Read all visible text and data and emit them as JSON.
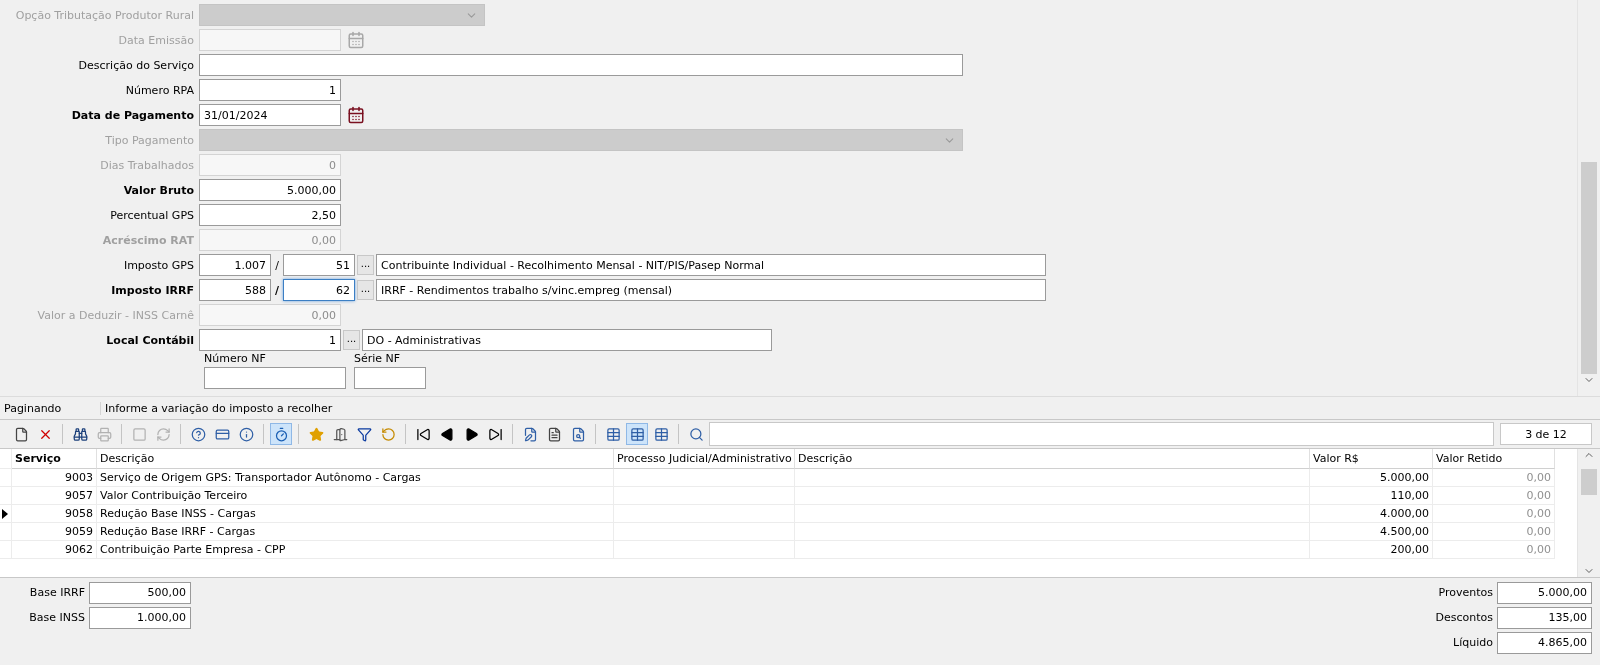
{
  "form": {
    "rows": [
      {
        "kind": "select",
        "label": "Opção Tributação Produtor Rural",
        "disabled": true,
        "bold": false
      },
      {
        "kind": "date",
        "label": "Data Emissão",
        "disabled": true,
        "bold": false
      },
      {
        "kind": "text",
        "label": "Descrição do Serviço",
        "disabled": false,
        "bold": false
      },
      {
        "kind": "number",
        "label": "Número RPA",
        "value": "1",
        "disabled": false,
        "bold": false
      },
      {
        "kind": "date",
        "label": "Data de Pagamento",
        "value": "31/01/2024",
        "disabled": false,
        "bold": true
      },
      {
        "kind": "wide-select",
        "label": "Tipo Pagamento",
        "disabled": true,
        "bold": false
      },
      {
        "kind": "number",
        "label": "Dias Trabalhados",
        "value": "0",
        "disabled": true,
        "bold": false
      },
      {
        "kind": "number",
        "label": "Valor Bruto",
        "value": "5.000,00",
        "disabled": false,
        "bold": true
      },
      {
        "kind": "number",
        "label": "Percentual GPS",
        "value": "2,50",
        "disabled": false,
        "bold": false
      },
      {
        "kind": "number",
        "label": "Acréscimo RAT",
        "value": "0,00",
        "disabled": true,
        "bold": true
      },
      {
        "kind": "code",
        "label": "Imposto GPS",
        "code": "1.007",
        "separator": "/",
        "sub_code": "51",
        "focused": false,
        "button": "...",
        "description": "Contribuinte Individual - Recolhimento Mensal - NIT/PIS/Pasep Normal",
        "disabled": false,
        "bold": false
      },
      {
        "kind": "code",
        "label": "Imposto IRRF",
        "code": "588",
        "separator": "/",
        "sub_code": "62",
        "focused": true,
        "button": "...",
        "description": "IRRF - Rendimentos trabalho s/vinc.empreg (mensal)",
        "disabled": false,
        "bold": true
      },
      {
        "kind": "number",
        "label": "Valor a Deduzir - INSS Carnê",
        "value": "0,00",
        "disabled": true,
        "bold": false
      },
      {
        "kind": "lookup",
        "label": "Local Contábil",
        "code": "1",
        "button": "...",
        "description": "DO - Administrativas",
        "disabled": false,
        "bold": true
      },
      {
        "kind": "pair",
        "fields": [
          {
            "label": "Número NF"
          },
          {
            "label": "Série NF"
          }
        ]
      }
    ]
  },
  "status_bar": {
    "mode": "Paginando",
    "message": "Informe a variação do imposto a recolher"
  },
  "toolbar": {
    "items": [
      {
        "kind": "new",
        "disabled": false,
        "pressed": false
      },
      {
        "kind": "delete",
        "disabled": false,
        "pressed": false
      },
      {
        "kind": "sep"
      },
      {
        "kind": "find",
        "disabled": false,
        "pressed": false
      },
      {
        "kind": "print",
        "disabled": true,
        "pressed": false
      },
      {
        "kind": "sep"
      },
      {
        "kind": "save",
        "disabled": true,
        "pressed": false
      },
      {
        "kind": "refresh",
        "disabled": true,
        "pressed": false
      },
      {
        "kind": "sep"
      },
      {
        "kind": "help",
        "disabled": false,
        "pressed": false
      },
      {
        "kind": "card",
        "disabled": false,
        "pressed": false
      },
      {
        "kind": "info",
        "disabled": false,
        "pressed": false
      },
      {
        "kind": "sep"
      },
      {
        "kind": "timer",
        "disabled": false,
        "pressed": true
      },
      {
        "kind": "sep"
      },
      {
        "kind": "favorite",
        "disabled": false,
        "pressed": false
      },
      {
        "kind": "exit",
        "disabled": false,
        "pressed": false
      },
      {
        "kind": "filter",
        "disabled": false,
        "pressed": false
      },
      {
        "kind": "reload",
        "disabled": false,
        "pressed": false
      },
      {
        "kind": "sep"
      },
      {
        "kind": "first",
        "disabled": false,
        "pressed": false
      },
      {
        "kind": "prev",
        "disabled": false,
        "pressed": false
      },
      {
        "kind": "next",
        "disabled": false,
        "pressed": false
      },
      {
        "kind": "last",
        "disabled": false,
        "pressed": false
      },
      {
        "kind": "sep"
      },
      {
        "kind": "edit",
        "disabled": false,
        "pressed": false
      },
      {
        "kind": "report",
        "disabled": false,
        "pressed": false
      },
      {
        "kind": "preview",
        "disabled": false,
        "pressed": false
      },
      {
        "kind": "sep"
      },
      {
        "kind": "grid",
        "disabled": false,
        "pressed": false
      },
      {
        "kind": "grid",
        "disabled": false,
        "pressed": true
      },
      {
        "kind": "grid",
        "disabled": false,
        "pressed": false
      },
      {
        "kind": "sep"
      },
      {
        "kind": "zoom",
        "disabled": false,
        "pressed": false
      }
    ],
    "counter": "3 de 12"
  },
  "table": {
    "columns": [
      "Serviço",
      "Descrição",
      "Processo Judicial/Administrativo",
      "Descrição",
      "Valor R$",
      "Valor Retido"
    ],
    "rows": [
      {
        "selected": false,
        "cells": [
          "9003",
          "Serviço de Origem GPS: Transportador Autônomo - Cargas",
          "",
          "",
          "5.000,00",
          "0,00"
        ]
      },
      {
        "selected": false,
        "cells": [
          "9057",
          "Valor Contribuição Terceiro",
          "",
          "",
          "110,00",
          "0,00"
        ]
      },
      {
        "selected": true,
        "cells": [
          "9058",
          "Redução Base INSS - Cargas",
          "",
          "",
          "4.000,00",
          "0,00"
        ]
      },
      {
        "selected": false,
        "cells": [
          "9059",
          "Redução Base IRRF - Cargas",
          "",
          "",
          "4.500,00",
          "0,00"
        ]
      },
      {
        "selected": false,
        "cells": [
          "9062",
          "Contribuição Parte Empresa - CPP",
          "",
          "",
          "200,00",
          "0,00"
        ]
      }
    ]
  },
  "totals": {
    "left": [
      {
        "label": "Base IRRF",
        "value": "500,00"
      },
      {
        "label": "Base INSS",
        "value": "1.000,00"
      }
    ],
    "right": [
      {
        "label": "Proventos",
        "value": "5.000,00"
      },
      {
        "label": "Descontos",
        "value": "135,00"
      },
      {
        "label": "Líquido",
        "value": "4.865,00"
      }
    ]
  }
}
